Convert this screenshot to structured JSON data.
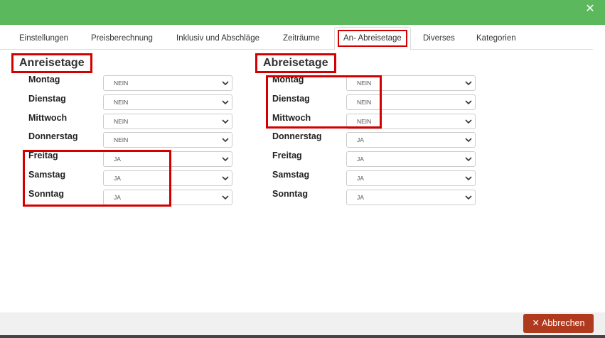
{
  "dialog": {
    "close_icon": "close-icon",
    "close_glyph": "✕"
  },
  "tabs": [
    {
      "label": "Einstellungen"
    },
    {
      "label": "Preisberechnung"
    },
    {
      "label": "Inklusiv und Abschläge"
    },
    {
      "label": "Zeiträume"
    },
    {
      "label": "An- Abreisetage",
      "active": true
    },
    {
      "label": "Diverses"
    },
    {
      "label": "Kategorien"
    }
  ],
  "anreise": {
    "title": "Anreisetage",
    "days": [
      {
        "label": "Montag",
        "value": "NEIN"
      },
      {
        "label": "Dienstag",
        "value": "NEIN"
      },
      {
        "label": "Mittwoch",
        "value": "NEIN"
      },
      {
        "label": "Donnerstag",
        "value": "NEIN"
      },
      {
        "label": "Freitag",
        "value": "JA"
      },
      {
        "label": "Samstag",
        "value": "JA"
      },
      {
        "label": "Sonntag",
        "value": "JA"
      }
    ]
  },
  "abreise": {
    "title": "Abreisetage",
    "days": [
      {
        "label": "Montag",
        "value": "NEIN"
      },
      {
        "label": "Dienstag",
        "value": "NEIN"
      },
      {
        "label": "Mittwoch",
        "value": "NEIN"
      },
      {
        "label": "Donnerstag",
        "value": "JA"
      },
      {
        "label": "Freitag",
        "value": "JA"
      },
      {
        "label": "Samstag",
        "value": "JA"
      },
      {
        "label": "Sonntag",
        "value": "JA"
      }
    ]
  },
  "footer": {
    "cancel_label": "Abbrechen",
    "cancel_glyph": "✕"
  },
  "colors": {
    "header_green": "#5cb85c",
    "highlight_red": "#d40000",
    "cancel_button": "#b03a1e"
  }
}
